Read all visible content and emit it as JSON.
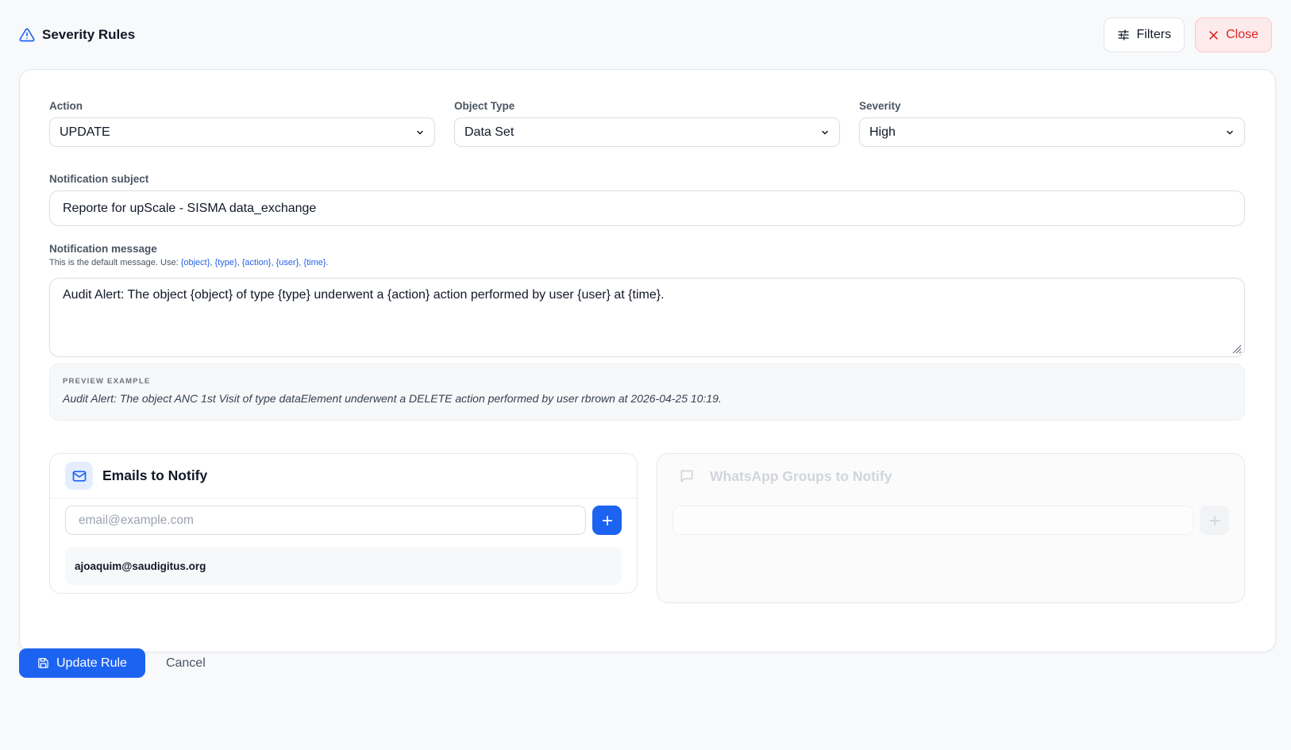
{
  "header": {
    "title": "Severity Rules",
    "filters_label": "Filters",
    "close_label": "Close"
  },
  "form": {
    "action": {
      "label": "Action",
      "value": "UPDATE"
    },
    "object_type": {
      "label": "Object Type",
      "value": "Data Set"
    },
    "severity": {
      "label": "Severity",
      "value": "High"
    },
    "subject": {
      "label": "Notification subject",
      "value": "Reporte for upScale - SISMA data_exchange"
    },
    "message": {
      "label": "Notification message",
      "hint": "This is the default message. Use: ",
      "tokens": "{object}, {type}, {action}, {user}, {time}.",
      "value": "Audit Alert: The object {object} of type {type} underwent a {action} action performed by user {user} at {time}."
    },
    "preview": {
      "label": "PREVIEW EXAMPLE",
      "text": "Audit Alert: The object ANC 1st Visit of type dataElement underwent a DELETE action performed by user rbrown at 2026-04-25 10:19."
    }
  },
  "emails": {
    "title": "Emails to Notify",
    "placeholder": "email@example.com",
    "items": [
      "ajoaquim@saudigitus.org"
    ]
  },
  "whatsapp": {
    "title": "WhatsApp Groups to Notify",
    "placeholder": ""
  },
  "footer": {
    "update_label": "Update Rule",
    "cancel_label": "Cancel"
  },
  "colors": {
    "primary": "#1d63f2",
    "danger": "#dc2626",
    "danger_bg": "#fdeaea",
    "token": "#2563eb"
  }
}
